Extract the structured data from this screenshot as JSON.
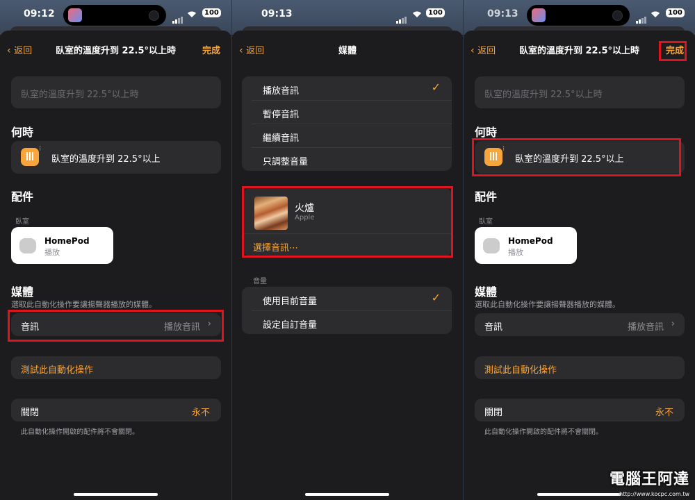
{
  "screens": [
    {
      "time": "09:12",
      "battery": "100",
      "back": "返回",
      "title": "臥室的溫度升到 22.5°以上時",
      "done": "完成",
      "name_field": "臥室的溫度升到 22.5°以上時",
      "when_header": "何時",
      "trigger": "臥室的溫度升到 22.5°以上",
      "accessories_header": "配件",
      "room": "臥室",
      "device_name": "HomePod",
      "device_state": "播放",
      "media_header": "媒體",
      "media_sub": "選取此自動化操作要讓揚聲器播放的媒體。",
      "audio_label": "音訊",
      "audio_value": "播放音訊",
      "test_label": "測試此自動化操作",
      "off_label": "關閉",
      "off_value": "永不",
      "off_note": "此自動化操作開啟的配件將不會關閉。"
    },
    {
      "time": "09:13",
      "battery": "100",
      "back": "返回",
      "title": "媒體",
      "actions": [
        {
          "label": "播放音訊",
          "checked": true
        },
        {
          "label": "暫停音訊",
          "checked": false
        },
        {
          "label": "繼續音訊",
          "checked": false
        },
        {
          "label": "只調整音量",
          "checked": false
        }
      ],
      "track_title": "火爐",
      "track_artist": "Apple",
      "choose_audio": "選擇音訊⋯",
      "volume_header": "音量",
      "volume_options": [
        {
          "label": "使用目前音量",
          "checked": true
        },
        {
          "label": "設定自訂音量",
          "checked": false
        }
      ]
    },
    {
      "time": "09:13",
      "battery": "100",
      "back": "返回",
      "title": "臥室的溫度升到 22.5°以上時",
      "done": "完成",
      "name_field": "臥室的溫度升到 22.5°以上時",
      "when_header": "何時",
      "trigger": "臥室的溫度升到 22.5°以上",
      "accessories_header": "配件",
      "room": "臥室",
      "device_name": "HomePod",
      "device_state": "播放",
      "media_header": "媒體",
      "media_sub": "選取此自動化操作要讓揚聲器播放的媒體。",
      "audio_label": "音訊",
      "audio_value": "播放音訊",
      "test_label": "測試此自動化操作",
      "off_label": "關閉",
      "off_value": "永不",
      "off_note": "此自動化操作開啟的配件將不會關閉。"
    }
  ],
  "watermark": "電腦王阿達",
  "watermark_url": "http://www.kocpc.com.tw",
  "colors": {
    "accent": "#f7a53c",
    "highlight": "#e0141e",
    "background": "#1c1c1e",
    "card": "#2c2c2e"
  }
}
